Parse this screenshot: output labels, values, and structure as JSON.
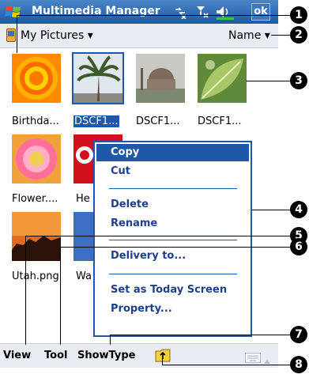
{
  "title_bar": {
    "app_title": "Multimedia Manager",
    "ok_label": "ok"
  },
  "toolbar": {
    "folder_label": "My Pictures ▾",
    "sort_label": "Name ▾"
  },
  "thumbnails": [
    {
      "caption": "Birthda...",
      "icon": "birthday-image"
    },
    {
      "caption": "DSCF1...",
      "icon": "palm-tree-image",
      "selected": true
    },
    {
      "caption": "DSCF1...",
      "icon": "mosque-image"
    },
    {
      "caption": "DSCF1...",
      "icon": "leaf-image"
    },
    {
      "caption": "Flower....",
      "icon": "flower-image"
    },
    {
      "caption": "He",
      "icon": "heart-image"
    },
    {
      "caption": "Utah.png",
      "icon": "utah-image"
    },
    {
      "caption": "Wa",
      "icon": "water-image"
    }
  ],
  "context_menu": {
    "items": [
      "Copy",
      "Cut",
      "Delete",
      "Rename",
      "Delivery to...",
      "Set as Today Screen",
      "Property..."
    ],
    "highlighted": "Copy"
  },
  "bottom_menu": {
    "view": "View",
    "tool": "Tool",
    "show_type": "ShowType"
  },
  "callouts": [
    "1",
    "2",
    "3",
    "4",
    "5",
    "6",
    "7",
    "8"
  ],
  "colors": {
    "title_bar": "#1f58a6",
    "menu_text": "#1f3f8a",
    "toolbar_bg": "#e9ecf2"
  }
}
